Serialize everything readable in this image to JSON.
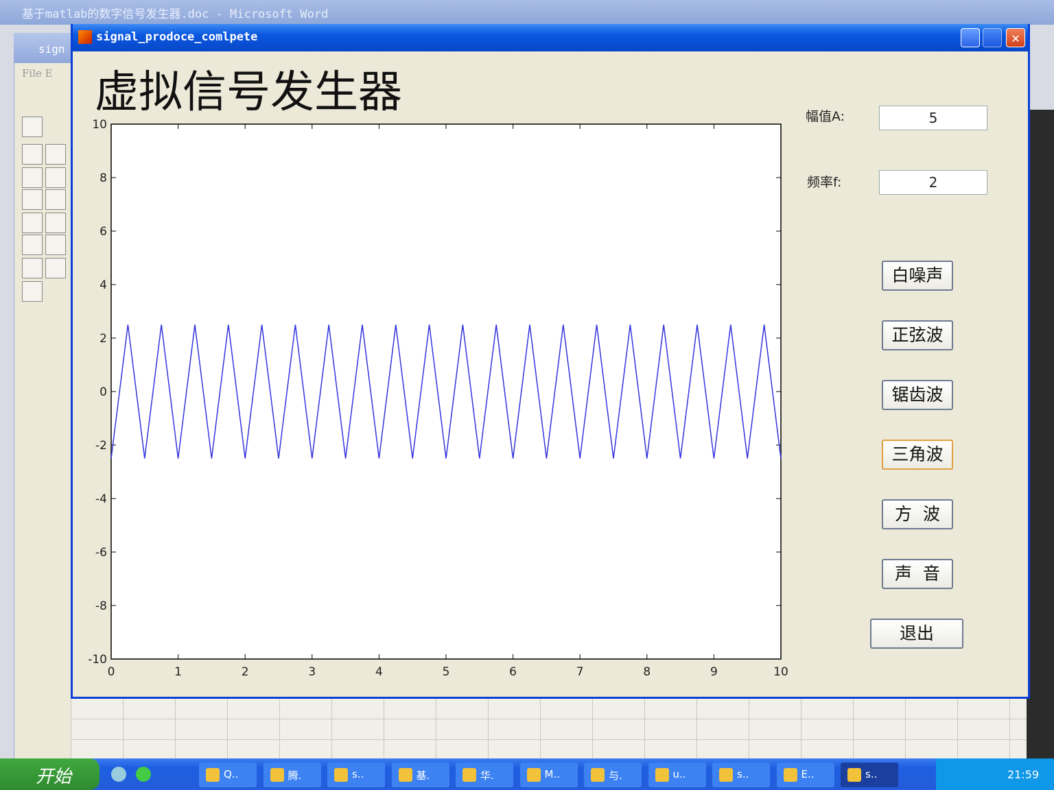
{
  "word": {
    "title": "基于matlab的数字信号发生器.doc - Microsoft Word",
    "guide_title": "sign",
    "menu": "File E"
  },
  "window": {
    "title": "signal_prodoce_comlpete",
    "heading": "虚拟信号发生器"
  },
  "controls": {
    "amplitude": {
      "label": "幅值A:",
      "value": "5"
    },
    "frequency": {
      "label": "频率f:",
      "value": "2"
    },
    "buttons": [
      {
        "label": "白噪声"
      },
      {
        "label": "正弦波"
      },
      {
        "label": "锯齿波"
      },
      {
        "label": "三角波"
      },
      {
        "label": "方  波"
      },
      {
        "label": "声  音"
      },
      {
        "label": "退出"
      }
    ]
  },
  "chart_data": {
    "type": "line",
    "title": "",
    "xlabel": "",
    "ylabel": "",
    "xlim": [
      0,
      10
    ],
    "ylim": [
      -10,
      10
    ],
    "xticks": [
      "0",
      "1",
      "2",
      "3",
      "4",
      "5",
      "6",
      "7",
      "8",
      "9",
      "10"
    ],
    "yticks": [
      "10",
      "8",
      "6",
      "4",
      "2",
      "0",
      "-2",
      "-4",
      "-6",
      "-8",
      "-10"
    ],
    "grid": false,
    "series": [
      {
        "waveform": "triangle",
        "amplitude": 2.5,
        "frequency": 2,
        "color": "#3333dd"
      }
    ]
  },
  "taskbar": {
    "start": "开始",
    "items": [
      "Q..",
      "腾.",
      "s..",
      "基.",
      "华.",
      "M..",
      "与.",
      "u..",
      "s..",
      "E..",
      "s.."
    ],
    "clock": "21:59"
  }
}
